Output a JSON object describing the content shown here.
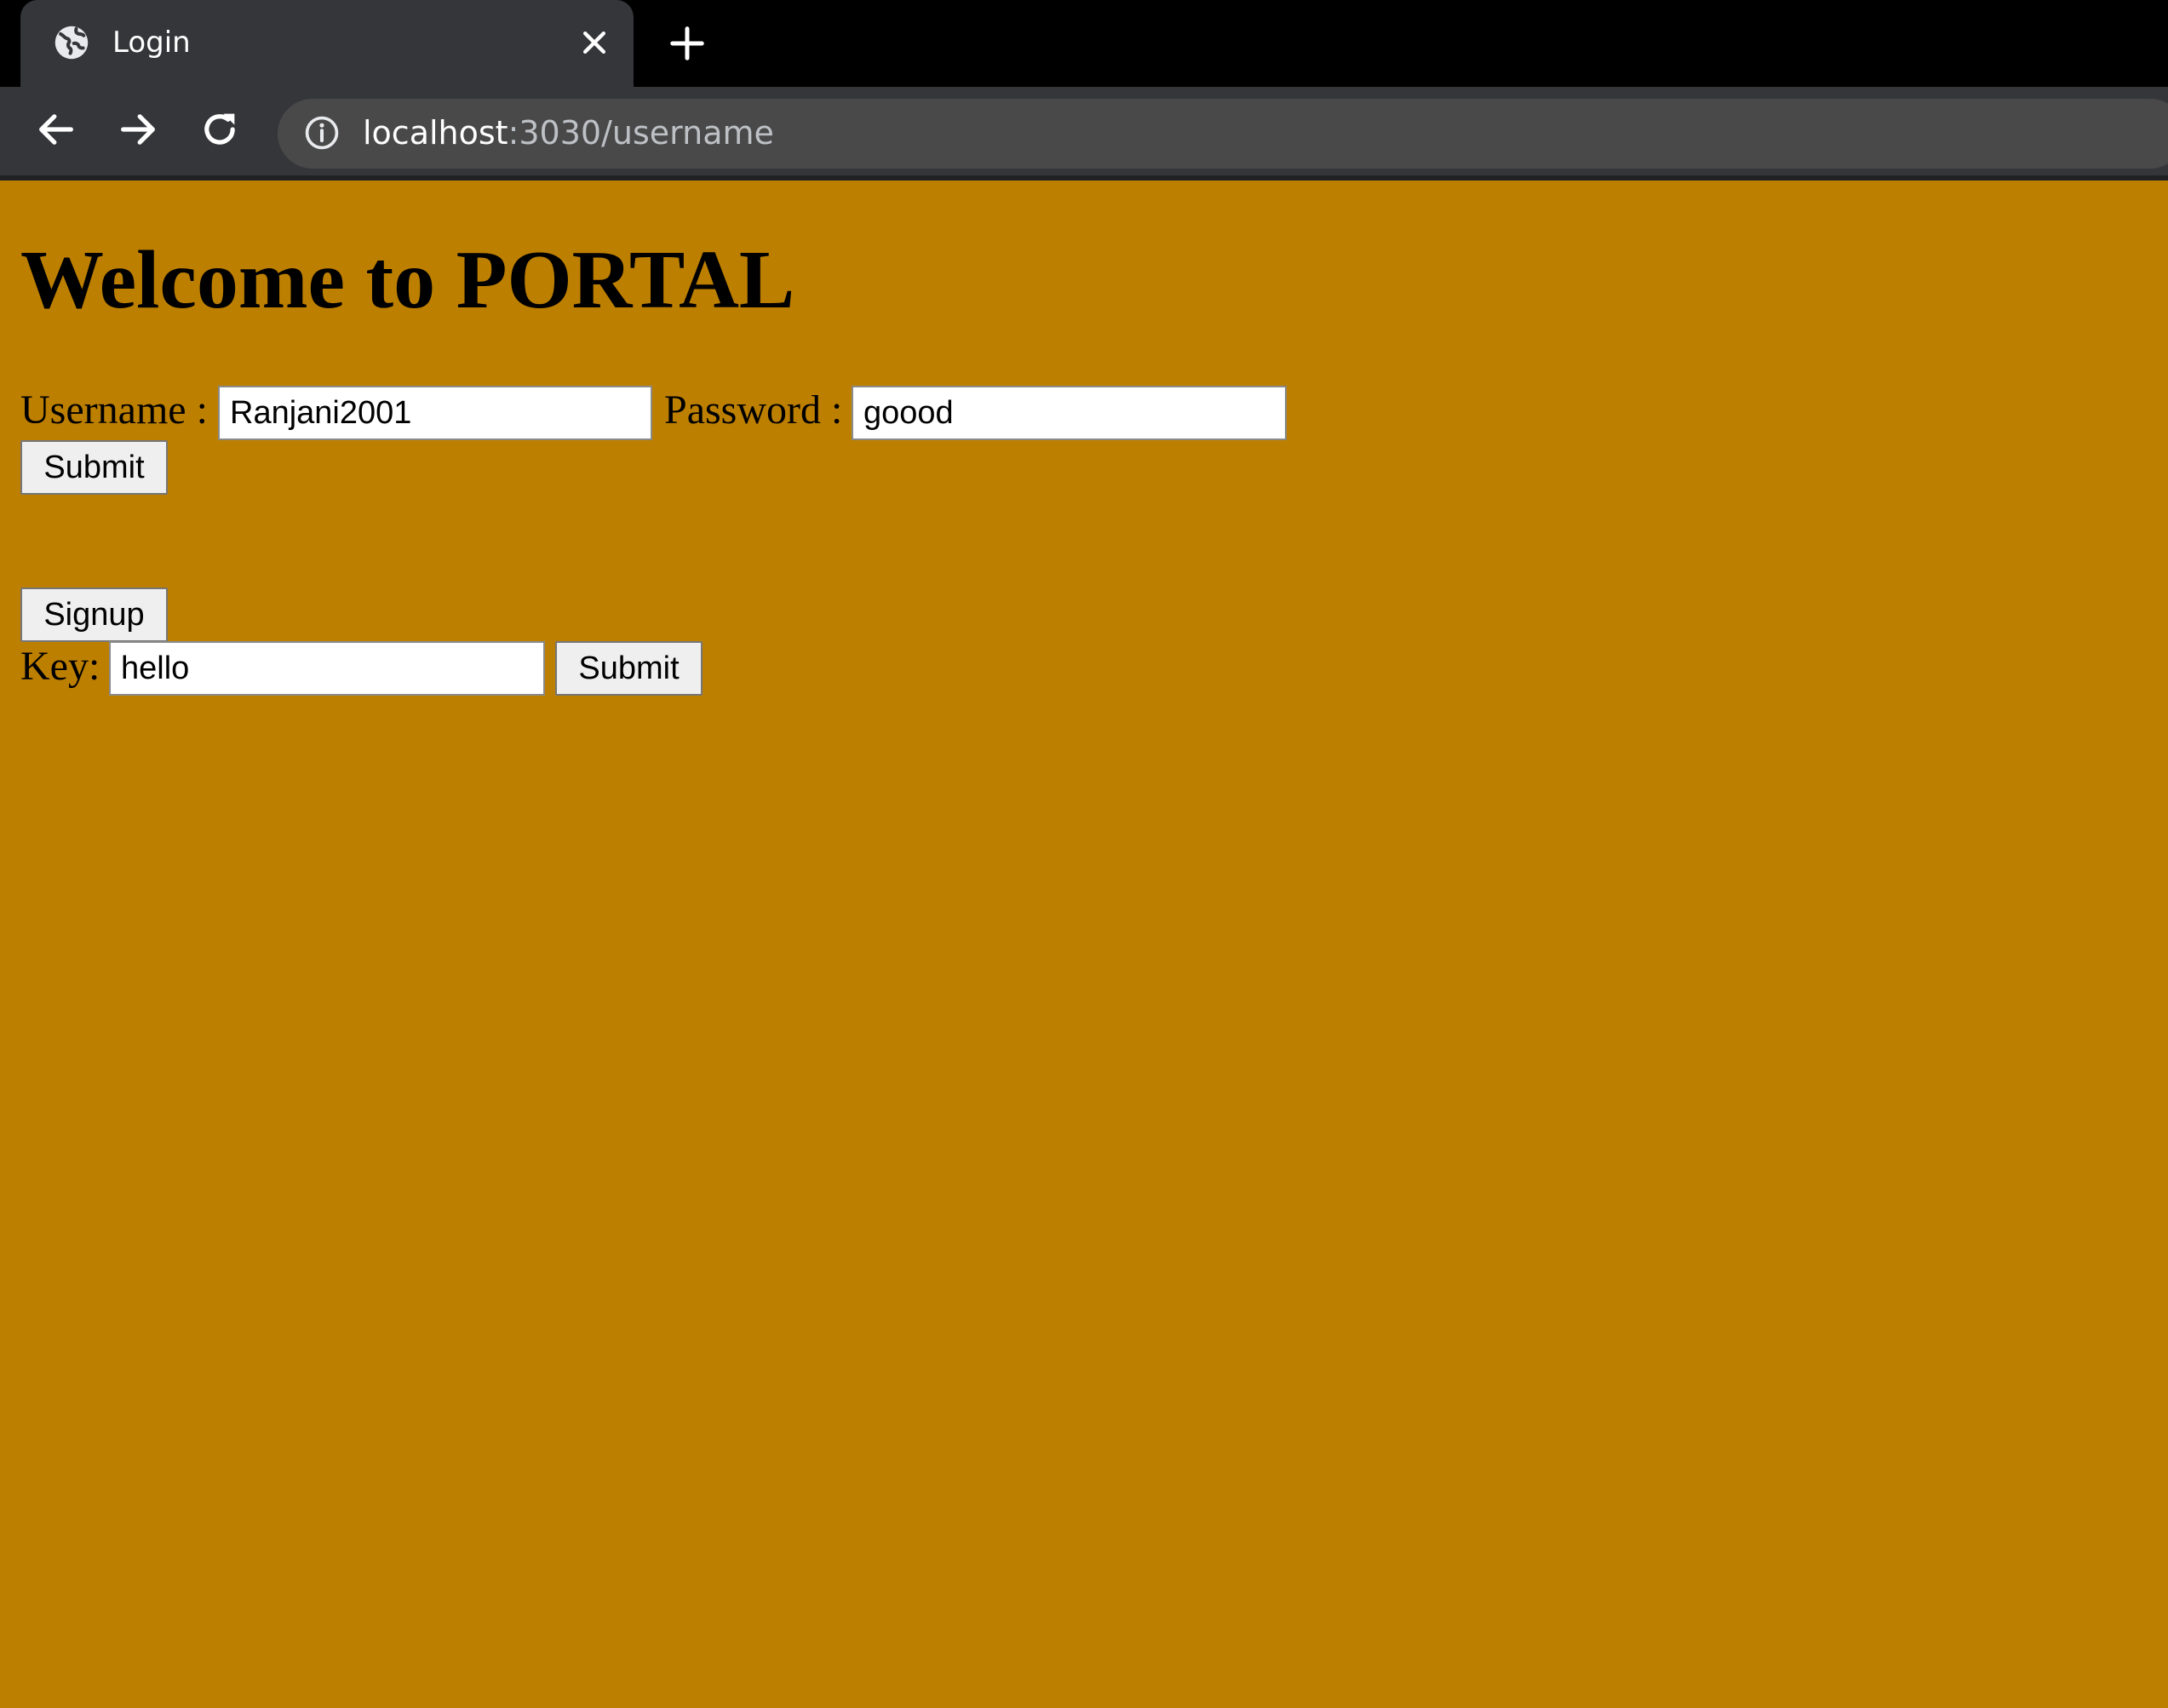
{
  "browser": {
    "tab": {
      "title": "Login",
      "icon": "globe-icon",
      "close_icon": "close-icon"
    },
    "new_tab_icon": "plus-icon",
    "nav": {
      "back_icon": "back-arrow-icon",
      "forward_icon": "forward-arrow-icon",
      "reload_icon": "reload-icon"
    },
    "address": {
      "info_icon": "info-icon",
      "host": "localhost",
      "rest": ":3030/username"
    }
  },
  "page": {
    "background": "#bd7f00",
    "heading": "Welcome to PORTAL",
    "login": {
      "username_label": "Username :",
      "username_value": "Ranjani2001",
      "password_label": "Password :",
      "password_value": "goood",
      "submit_label": "Submit"
    },
    "signup_label": "Signup",
    "key": {
      "label": "Key:",
      "value": "hello",
      "submit_label": "Submit"
    }
  }
}
